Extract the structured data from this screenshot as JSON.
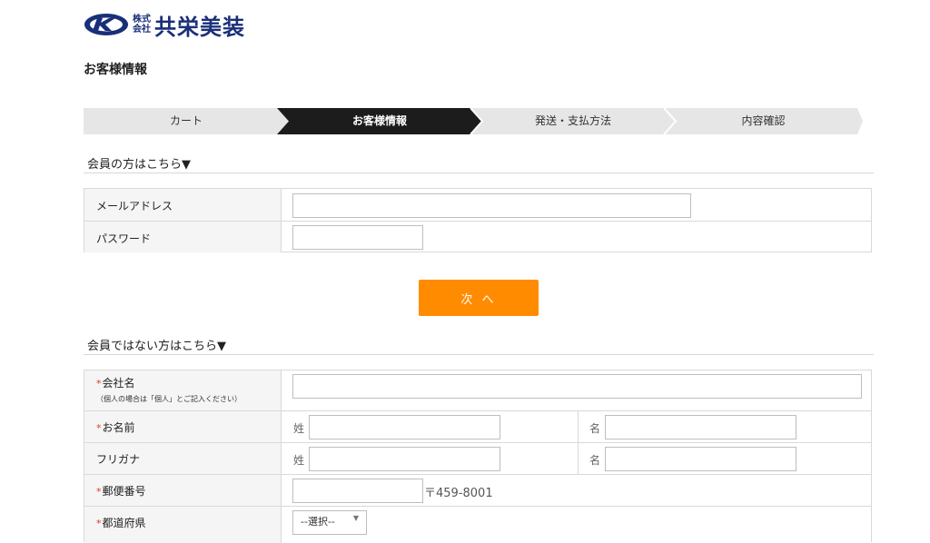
{
  "brand": {
    "small_top": "株式",
    "small_bottom": "会社",
    "name": "共栄美装",
    "color": "#1a2f7a"
  },
  "page_title": "お客様情報",
  "steps": [
    {
      "label": "カート",
      "active": false
    },
    {
      "label": "お客様情報",
      "active": true
    },
    {
      "label": "発送・支払方法",
      "active": false
    },
    {
      "label": "内容確認",
      "active": false
    }
  ],
  "member": {
    "heading": "会員の方はこちら▼",
    "email_label": "メールアドレス",
    "email_value": "",
    "password_label": "パスワード",
    "password_value": "",
    "next_label": "次 へ"
  },
  "guest": {
    "heading": "会員ではない方はこちら▼",
    "required_mark": "*",
    "company_label": "会社名",
    "company_note": "（個人の場合は「個人」とご記入ください）",
    "company_value": "",
    "name_label": "お名前",
    "last_label": "姓",
    "first_label": "名",
    "furigana_label": "フリガナ",
    "zip_label": "郵便番号",
    "zip_value": "",
    "zip_example": "〒459-8001",
    "pref_label": "都道府県",
    "pref_selected": "--選択--"
  },
  "colors": {
    "accent": "#ff8c00",
    "step_active": "#1c1c1c",
    "step_inactive": "#e6e6e6",
    "required": "#e23a1f"
  }
}
